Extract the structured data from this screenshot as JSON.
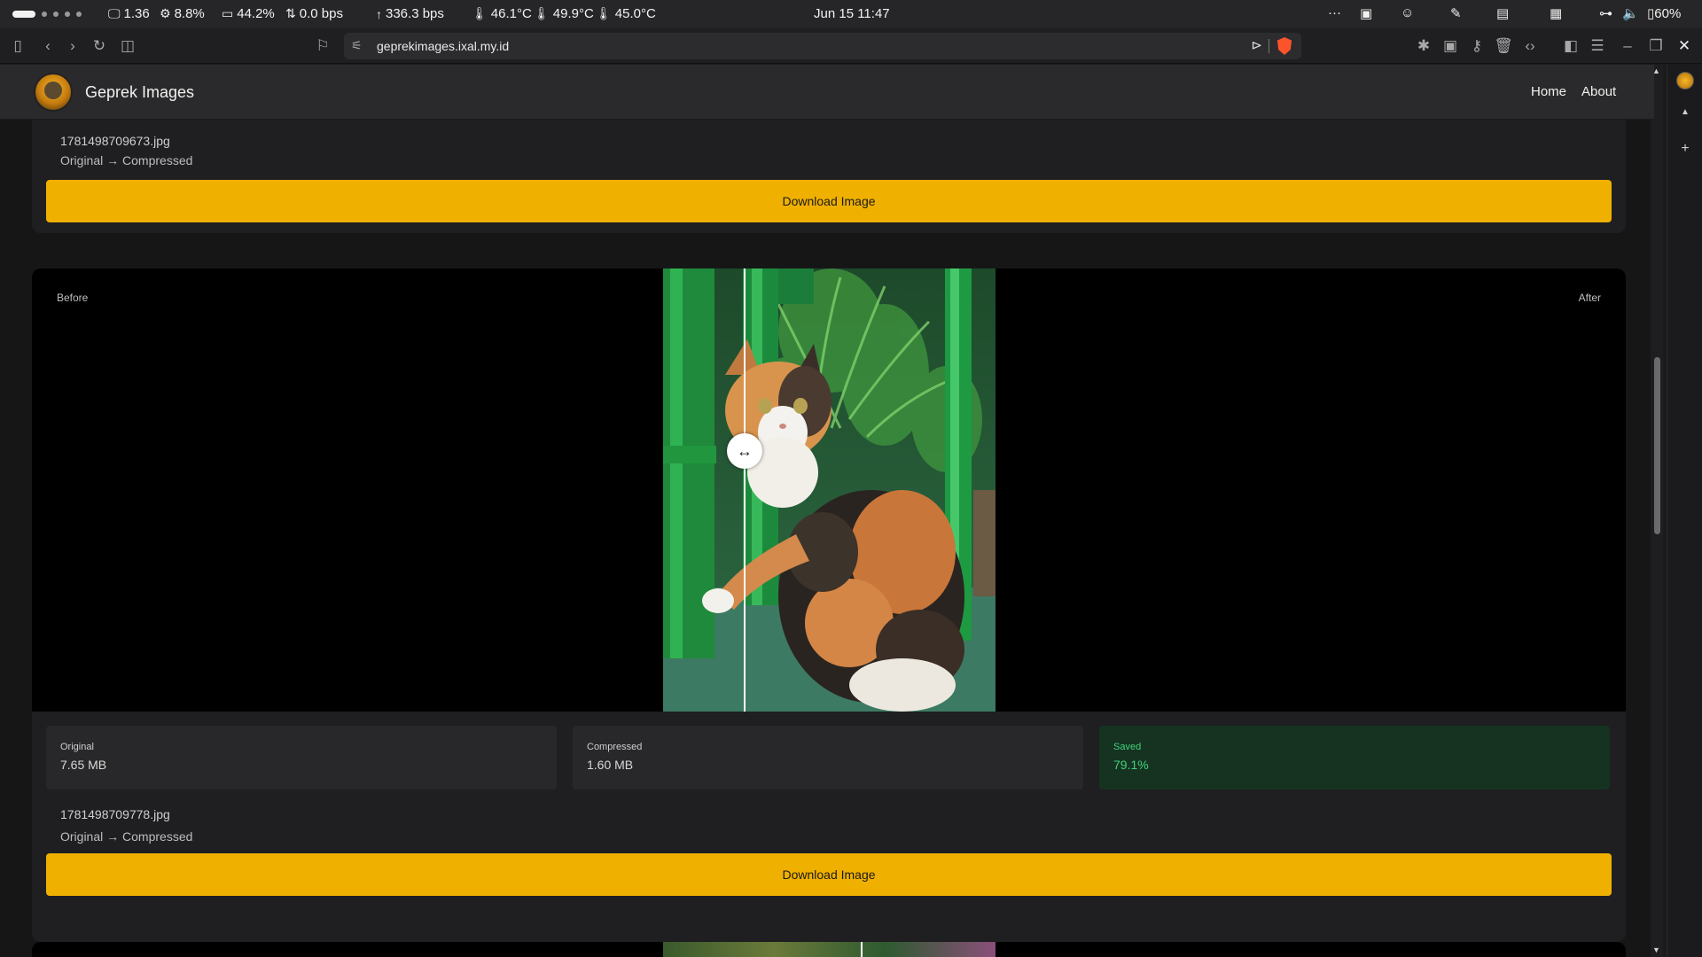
{
  "os_bar": {
    "load": "1.36",
    "cpu": "8.8%",
    "mem": "44.2%",
    "net_down": "0.0 bps",
    "net_up": "336.3 bps",
    "temp1": "46.1°C",
    "temp2": "49.9°C",
    "temp3": "45.0°C",
    "datetime": "Jun 15  11:47",
    "more": "···",
    "battery": "60%"
  },
  "browser": {
    "url": "geprekimages.ixal.my.id"
  },
  "site": {
    "brand": "Geprek Images",
    "nav": [
      "Home",
      "About"
    ]
  },
  "results": [
    {
      "filename": "1781498709673.jpg",
      "subtitle": "Original → Compressed",
      "download_label": "Download Image"
    },
    {
      "compare_before": "Before",
      "compare_after": "After",
      "original_label": "Original",
      "original_value": "7.65 MB",
      "compressed_label": "Compressed",
      "compressed_value": "1.60 MB",
      "saved_label": "Saved",
      "saved_value": "79.1%",
      "filename": "1781498709778.jpg",
      "subtitle": "Original → Compressed",
      "download_label": "Download Image",
      "slider_position": 0.245
    }
  ],
  "icons": {
    "colors": {
      "accent": "#f0b000",
      "saved_green": "#3fd37b"
    }
  }
}
